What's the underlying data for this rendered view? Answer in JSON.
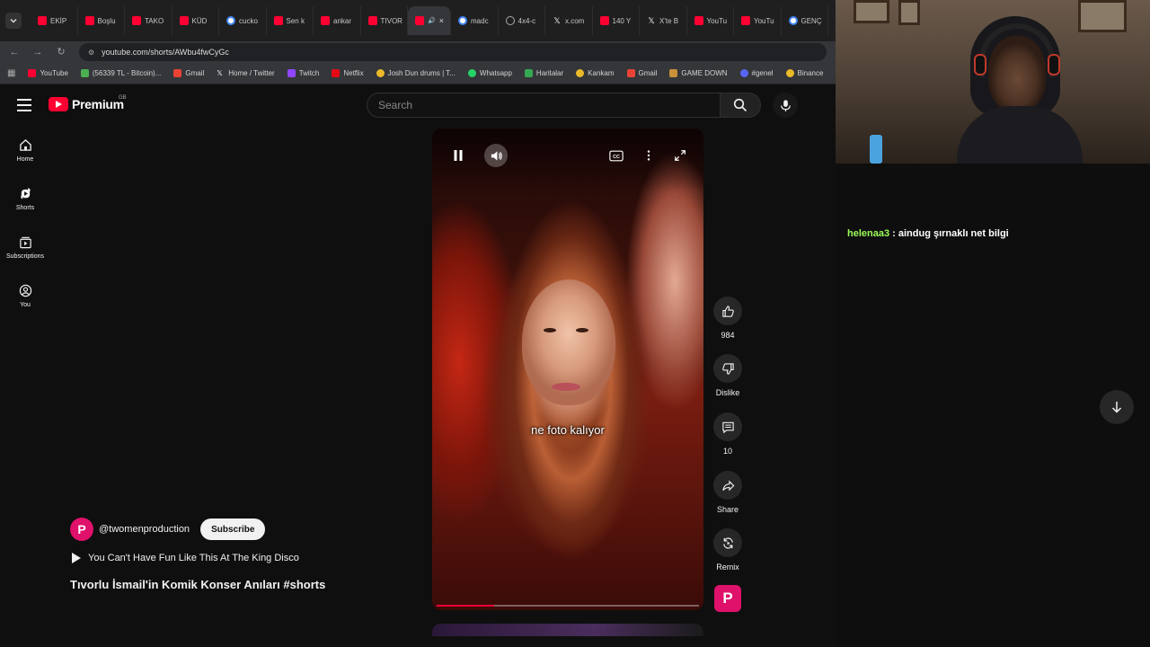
{
  "browser": {
    "tabs": [
      {
        "label": "EKİP",
        "icon": "youtube"
      },
      {
        "label": "Boşlu",
        "icon": "youtube"
      },
      {
        "label": "TAKO",
        "icon": "youtube"
      },
      {
        "label": "KÜD",
        "icon": "youtube"
      },
      {
        "label": "cucko",
        "icon": "google"
      },
      {
        "label": "Sen k",
        "icon": "youtube"
      },
      {
        "label": "ankar",
        "icon": "youtube"
      },
      {
        "label": "TIVOR",
        "icon": "youtube"
      },
      {
        "label": "",
        "icon": "youtube",
        "active": true
      },
      {
        "label": "madc",
        "icon": "google"
      },
      {
        "label": "4x4-c",
        "icon": "globe"
      },
      {
        "label": "x.com",
        "icon": "x"
      },
      {
        "label": "140 Y",
        "icon": "youtube"
      },
      {
        "label": "X'te B",
        "icon": "x"
      },
      {
        "label": "YouTu",
        "icon": "youtube"
      },
      {
        "label": "YouTu",
        "icon": "youtube"
      },
      {
        "label": "GENÇ",
        "icon": "google"
      }
    ],
    "url": "youtube.com/shorts/AWbu4fwCyGc",
    "bookmarks": [
      {
        "label": "YouTube",
        "icon": "youtube"
      },
      {
        "label": "(56339 TL - Bitcoin)...",
        "icon": "bitcoin"
      },
      {
        "label": "Gmail",
        "icon": "gmail"
      },
      {
        "label": "Home / Twitter",
        "icon": "x"
      },
      {
        "label": "Twitch",
        "icon": "twitch"
      },
      {
        "label": "Netflix",
        "icon": "netflix"
      },
      {
        "label": "Josh Dun drums | T...",
        "icon": "globe"
      },
      {
        "label": "Whatsapp",
        "icon": "whatsapp"
      },
      {
        "label": "Haritalar",
        "icon": "maps"
      },
      {
        "label": "Kankam",
        "icon": "globe"
      },
      {
        "label": "Gmail",
        "icon": "gmail"
      },
      {
        "label": "GAME DOWN",
        "icon": "folder"
      },
      {
        "label": "#genel",
        "icon": "discord"
      },
      {
        "label": "Binance",
        "icon": "globe"
      }
    ]
  },
  "youtube": {
    "logo_text": "Premium",
    "country_code": "GB",
    "search_placeholder": "Search",
    "sidebar": [
      {
        "label": "Home",
        "icon": "home-icon"
      },
      {
        "label": "Shorts",
        "icon": "shorts-icon"
      },
      {
        "label": "Subscriptions",
        "icon": "subscriptions-icon"
      },
      {
        "label": "You",
        "icon": "you-icon"
      }
    ],
    "short": {
      "caption": "ne foto kalıyor",
      "progress_fraction": 0.22,
      "channel": "@twomenproduction",
      "subscribe_label": "Subscribe",
      "music": "You Can't Have Fun Like This At The King Disco",
      "title": "Tıvorlu İsmail'in Komik Konser Anıları #shorts"
    },
    "actions": {
      "like_count": "984",
      "dislike_label": "Dislike",
      "comment_count": "10",
      "share_label": "Share",
      "remix_label": "Remix"
    }
  },
  "chat": {
    "username": "helenaa3",
    "message": " : aindug şırnaklı net bilgi"
  },
  "colors": {
    "youtube_red": "#ff0033",
    "channel_pink": "#e0116b",
    "chat_user_green": "#9bff5a"
  }
}
